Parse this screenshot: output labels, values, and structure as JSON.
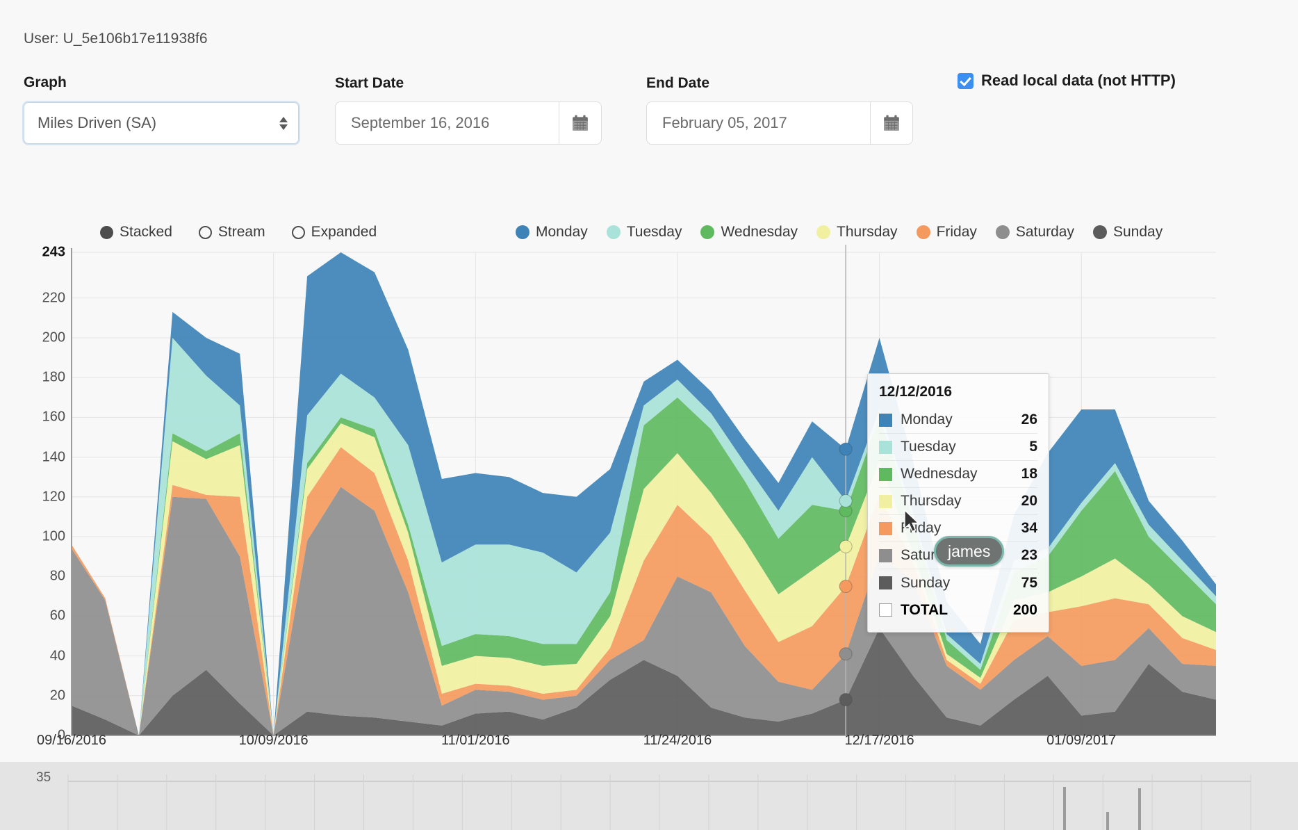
{
  "header": {
    "user_label": "User: U_5e106b17e11938f6",
    "graph_label": "Graph",
    "graph_value": "Miles Driven (SA)",
    "start_date_label": "Start Date",
    "start_date_value": "September 16, 2016",
    "end_date_label": "End Date",
    "end_date_value": "February 05, 2017",
    "read_local_label": "Read local data (not HTTP)",
    "read_local_checked": true,
    "calendar_icon": "calendar-icon",
    "stepper_icon": "updown-stepper-icon"
  },
  "mode_options": [
    {
      "label": "Stacked",
      "selected": true
    },
    {
      "label": "Stream",
      "selected": false
    },
    {
      "label": "Expanded",
      "selected": false
    }
  ],
  "tooltip": {
    "date": "12/12/2016",
    "rows": [
      {
        "name": "Monday",
        "value": "26",
        "color": "#3d83b8"
      },
      {
        "name": "Tuesday",
        "value": "5",
        "color": "#a8e2d8"
      },
      {
        "name": "Wednesday",
        "value": "18",
        "color": "#5fba5f"
      },
      {
        "name": "Thursday",
        "value": "20",
        "color": "#f0f0a0"
      },
      {
        "name": "Friday",
        "value": "34",
        "color": "#f49a5e"
      },
      {
        "name": "Saturday",
        "value": "23",
        "color": "#8e8e8e"
      },
      {
        "name": "Sunday",
        "value": "75",
        "color": "#5c5c5c"
      }
    ],
    "total_label": "TOTAL",
    "total_value": "200"
  },
  "peer_cursor": {
    "name": "james",
    "badge_color": "#6f7372",
    "border_color": "#79b8ab"
  },
  "mini_chart": {
    "ylabel": "35"
  },
  "chart_data": {
    "type": "area",
    "stacked": true,
    "title": "",
    "xlabel": "",
    "ylabel": "",
    "ylim": [
      0,
      243
    ],
    "yticks": [
      "0",
      "20",
      "40",
      "60",
      "80",
      "100",
      "120",
      "140",
      "160",
      "180",
      "200",
      "220",
      "243"
    ],
    "ytick_values": [
      0,
      20,
      40,
      60,
      80,
      100,
      120,
      140,
      160,
      180,
      200,
      220,
      243
    ],
    "xticks": [
      "09/16/2016",
      "10/09/2016",
      "11/01/2016",
      "11/24/2016",
      "12/17/2016",
      "01/09/2017"
    ],
    "xtick_indices": [
      0,
      6,
      12,
      18,
      24,
      30
    ],
    "grid": true,
    "legend_position": "top",
    "highlight_index": 23,
    "x": [
      0,
      1,
      2,
      3,
      4,
      5,
      6,
      7,
      8,
      9,
      10,
      11,
      12,
      13,
      14,
      15,
      16,
      17,
      18,
      19,
      20,
      21,
      22,
      23,
      24,
      25,
      26,
      27,
      28,
      29,
      30,
      31,
      32,
      33,
      34
    ],
    "series": [
      {
        "name": "Sunday",
        "color": "#5c5c5c",
        "values": [
          15,
          8,
          0,
          20,
          33,
          16,
          0,
          12,
          10,
          9,
          7,
          5,
          11,
          12,
          8,
          14,
          28,
          38,
          30,
          14,
          9,
          7,
          11,
          18,
          54,
          30,
          9,
          5,
          18,
          30,
          10,
          12,
          36,
          22,
          18
        ]
      },
      {
        "name": "Saturday",
        "color": "#8e8e8e",
        "values": [
          79,
          60,
          0,
          100,
          86,
          74,
          0,
          86,
          115,
          104,
          65,
          10,
          12,
          10,
          10,
          6,
          10,
          10,
          50,
          58,
          36,
          20,
          12,
          23,
          37,
          48,
          26,
          18,
          20,
          20,
          25,
          26,
          18,
          14,
          17
        ]
      },
      {
        "name": "Friday",
        "color": "#f49a5e",
        "values": [
          2,
          1,
          0,
          6,
          2,
          30,
          0,
          22,
          20,
          19,
          16,
          6,
          3,
          3,
          3,
          3,
          6,
          40,
          36,
          28,
          28,
          20,
          32,
          34,
          30,
          9,
          3,
          3,
          20,
          12,
          30,
          31,
          12,
          13,
          8
        ]
      },
      {
        "name": "Thursday",
        "color": "#f0f0a0",
        "values": [
          0,
          0,
          0,
          22,
          18,
          26,
          0,
          14,
          12,
          18,
          14,
          14,
          14,
          14,
          14,
          13,
          16,
          36,
          26,
          22,
          25,
          24,
          28,
          20,
          17,
          5,
          3,
          3,
          10,
          10,
          15,
          20,
          10,
          11,
          9
        ]
      },
      {
        "name": "Wednesday",
        "color": "#5fba5f",
        "values": [
          0,
          0,
          0,
          4,
          4,
          6,
          0,
          3,
          3,
          4,
          4,
          10,
          11,
          11,
          11,
          10,
          12,
          32,
          28,
          32,
          30,
          28,
          33,
          18,
          22,
          17,
          7,
          4,
          14,
          18,
          33,
          44,
          24,
          23,
          14
        ]
      },
      {
        "name": "Tuesday",
        "color": "#a8e2d8",
        "values": [
          0,
          0,
          0,
          48,
          38,
          14,
          0,
          24,
          22,
          16,
          40,
          42,
          45,
          46,
          46,
          36,
          30,
          10,
          9,
          8,
          9,
          14,
          24,
          5,
          4,
          3,
          3,
          3,
          6,
          4,
          4,
          4,
          6,
          5,
          4
        ]
      },
      {
        "name": "Monday",
        "color": "#3d83b8",
        "values": [
          0,
          0,
          0,
          13,
          19,
          26,
          0,
          70,
          61,
          63,
          48,
          42,
          36,
          34,
          30,
          38,
          32,
          12,
          10,
          11,
          12,
          14,
          18,
          26,
          36,
          26,
          16,
          10,
          23,
          48,
          47,
          27,
          12,
          10,
          6
        ]
      }
    ]
  }
}
